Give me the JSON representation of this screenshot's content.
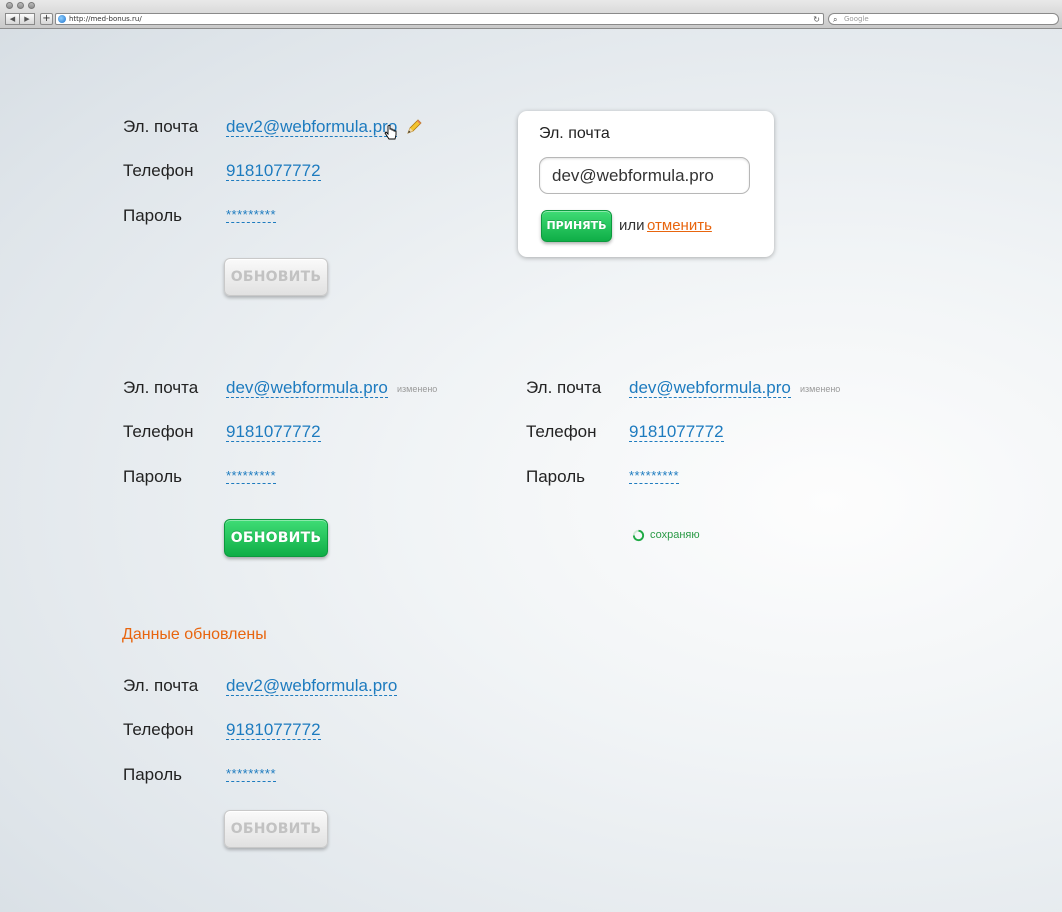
{
  "browser": {
    "url": "http://med-bonus.ru/",
    "search_placeholder": "Google",
    "back_glyph": "◀",
    "forward_glyph": "▶",
    "add_glyph": "+",
    "reload_glyph": "↻",
    "search_glyph": "⌕"
  },
  "labels": {
    "email": "Эл. почта",
    "phone": "Телефон",
    "password": "Пароль",
    "update": "ОБНОВИТЬ",
    "changed": "изменено",
    "saving": "сохраняю"
  },
  "form1": {
    "email": "dev2@webformula.pro",
    "phone": "9181077772",
    "password": "*********"
  },
  "form2": {
    "email": "dev@webformula.pro",
    "phone": "9181077772",
    "password": "*********"
  },
  "form3": {
    "email": "dev@webformula.pro",
    "phone": "9181077772",
    "password": "*********"
  },
  "form4": {
    "notice": "Данные обновлены",
    "email": "dev2@webformula.pro",
    "phone": "9181077772",
    "password": "*********"
  },
  "popup": {
    "label": "Эл. почта",
    "input_value": "dev@webformula.pro",
    "accept": "ПРИНЯТЬ",
    "or": "или",
    "cancel": "отменить"
  },
  "colors": {
    "link": "#1d7bbf",
    "accent_green": "#12b04a",
    "notice_orange": "#e8650e"
  }
}
